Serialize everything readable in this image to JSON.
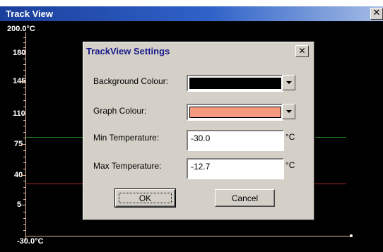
{
  "window": {
    "title": "Track View",
    "close_glyph": "✕"
  },
  "y_axis": {
    "top_label": "200.0°C",
    "bottom_label": "-30.0°C",
    "tick_labels": [
      "180",
      "145",
      "110",
      "75",
      "40",
      "5"
    ]
  },
  "plot": {
    "background_color": "#000000",
    "axis_color": "#e8b9a0",
    "green_line_color": "#1e8c1e",
    "red_line_color": "#a52a1e"
  },
  "dialog": {
    "title": "TrackView Settings",
    "close_glyph": "✕",
    "background_colour_label": "Background Colour:",
    "background_colour_value": "#000000",
    "graph_colour_label": "Graph Colour:",
    "graph_colour_value": "#f59a7e",
    "min_temp_label": "Min Temperature:",
    "min_temp_value": "-30.0",
    "min_temp_unit": "°C",
    "max_temp_label": "Max Temperature:",
    "max_temp_value": "-12.7",
    "max_temp_unit": "°C",
    "ok_label": "OK",
    "cancel_label": "Cancel"
  }
}
